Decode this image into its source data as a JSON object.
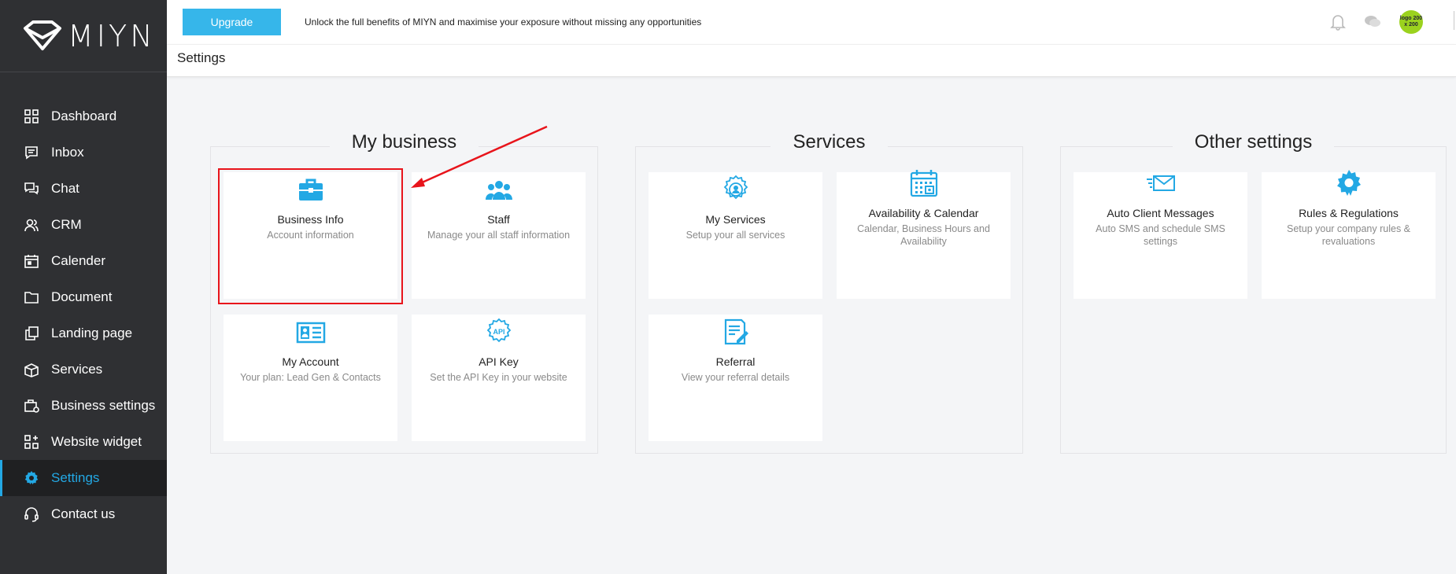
{
  "app": {
    "logo_text": "MIYN"
  },
  "sidebar": {
    "items": [
      {
        "label": "Dashboard",
        "icon": "grid-icon"
      },
      {
        "label": "Inbox",
        "icon": "message-icon"
      },
      {
        "label": "Chat",
        "icon": "chat-icon"
      },
      {
        "label": "CRM",
        "icon": "users-icon"
      },
      {
        "label": "Calender",
        "icon": "calendar-icon"
      },
      {
        "label": "Document",
        "icon": "folder-icon"
      },
      {
        "label": "Landing page",
        "icon": "pages-icon"
      },
      {
        "label": "Services",
        "icon": "box-icon"
      },
      {
        "label": "Business settings",
        "icon": "briefcase-icon"
      },
      {
        "label": "Website widget",
        "icon": "widget-icon"
      },
      {
        "label": "Settings",
        "icon": "gear-icon",
        "active": true
      },
      {
        "label": "Contact us",
        "icon": "headset-icon"
      }
    ]
  },
  "topbar": {
    "upgrade_label": "Upgrade",
    "banner": "Unlock the full benefits of MIYN and maximise your exposure without missing any opportunities",
    "avatar_text": "logo 200 x 200"
  },
  "page_title": "Settings",
  "groups": [
    {
      "title": "My business",
      "cards": [
        {
          "title": "Business Info",
          "desc": "Account information",
          "icon": "briefcase-icon"
        },
        {
          "title": "Staff",
          "desc": "Manage your all staff information",
          "icon": "team-icon"
        },
        {
          "title": "My Account",
          "desc": "Your plan: Lead Gen & Contacts",
          "icon": "id-card-icon"
        },
        {
          "title": "API Key",
          "desc": "Set the API Key in your website",
          "icon": "api-icon"
        }
      ]
    },
    {
      "title": "Services",
      "cards": [
        {
          "title": "My Services",
          "desc": "Setup your all services",
          "icon": "service-badge-icon"
        },
        {
          "title": "Availability & Calendar",
          "desc": "Calendar, Business Hours and Availability",
          "icon": "calendar-icon"
        },
        {
          "title": "Referral",
          "desc": "View your referral details",
          "icon": "referral-icon"
        }
      ]
    },
    {
      "title": "Other settings",
      "cards": [
        {
          "title": "Auto Client Messages",
          "desc": "Auto SMS and schedule SMS settings",
          "icon": "envelope-icon"
        },
        {
          "title": "Rules & Regulations",
          "desc": "Setup your company rules & revaluations",
          "icon": "gear-icon"
        }
      ]
    }
  ],
  "colors": {
    "accent": "#23a8e4",
    "sidebar_bg": "#2f3033",
    "highlight": "#e8141b",
    "upgrade": "#36b6ea"
  }
}
